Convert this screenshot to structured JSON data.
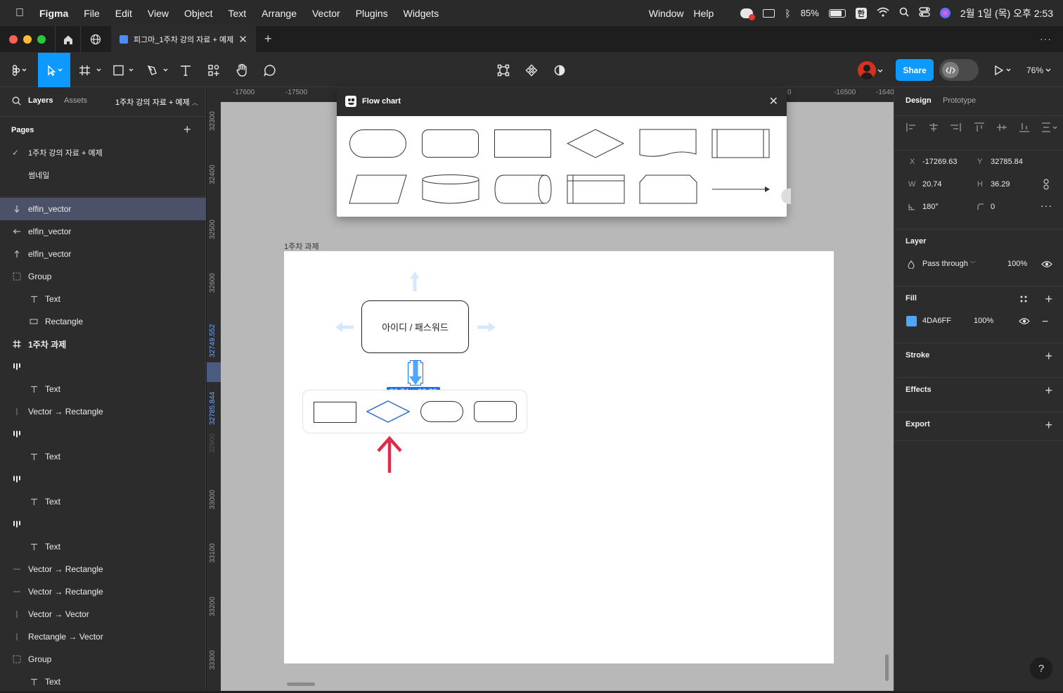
{
  "menubar": {
    "apple": "",
    "items": [
      "Figma",
      "File",
      "Edit",
      "View",
      "Object",
      "Text",
      "Arrange",
      "Vector",
      "Plugins",
      "Widgets"
    ],
    "right_items": [
      "Window",
      "Help"
    ],
    "battery": "85%",
    "ime": "한",
    "datetime": "2월 1일 (목) 오후 2:53"
  },
  "tabbar": {
    "tab_title": "피그마_1주차 강의 자료 + 예제",
    "add": "+",
    "more": "···"
  },
  "toolbar": {
    "share_label": "Share",
    "zoom": "76%"
  },
  "left_panel": {
    "tab_layers": "Layers",
    "tab_assets": "Assets",
    "file_name": "1주차 강의 자료 + 예제",
    "pages_title": "Pages",
    "pages": [
      {
        "label": "1주차 강의 자료 + 예제",
        "active": true
      },
      {
        "label": "썸네일",
        "active": false
      }
    ],
    "layers": [
      {
        "label": "elfin_vector",
        "icon": "vector-down-icon",
        "indent": 0,
        "selected": true
      },
      {
        "label": "elfin_vector",
        "icon": "vector-left-icon",
        "indent": 0
      },
      {
        "label": "elfin_vector",
        "icon": "vector-up-icon",
        "indent": 0
      },
      {
        "label": "Group",
        "icon": "group-icon",
        "indent": 0
      },
      {
        "label": "Text",
        "icon": "text-icon",
        "indent": 1
      },
      {
        "label": "Rectangle",
        "icon": "rectangle-icon",
        "indent": 1
      },
      {
        "label": "1주차 과제",
        "icon": "frame-icon",
        "indent": 0,
        "bold": true
      },
      {
        "label": "",
        "icon": "autolayout-icon",
        "indent": 0
      },
      {
        "label": "Text",
        "icon": "text-icon",
        "indent": 1
      },
      {
        "label": "Vector → Rectangle",
        "icon": "line-icon",
        "indent": 0
      },
      {
        "label": "",
        "icon": "autolayout-icon",
        "indent": 0
      },
      {
        "label": "Text",
        "icon": "text-icon",
        "indent": 1
      },
      {
        "label": "",
        "icon": "autolayout-icon",
        "indent": 0
      },
      {
        "label": "Text",
        "icon": "text-icon",
        "indent": 1
      },
      {
        "label": "",
        "icon": "autolayout-icon",
        "indent": 0
      },
      {
        "label": "Text",
        "icon": "text-icon",
        "indent": 1
      },
      {
        "label": "Vector → Rectangle",
        "icon": "hline-icon",
        "indent": 0
      },
      {
        "label": "Vector → Rectangle",
        "icon": "hline-icon",
        "indent": 0
      },
      {
        "label": "Vector → Vector",
        "icon": "line-icon",
        "indent": 0
      },
      {
        "label": "Rectangle → Vector",
        "icon": "line-icon",
        "indent": 0
      },
      {
        "label": "Group",
        "icon": "group-icon",
        "indent": 0
      },
      {
        "label": "Text",
        "icon": "text-icon",
        "indent": 1
      }
    ]
  },
  "rulers": {
    "h_ticks": [
      "-17600",
      "-17500",
      "-16500",
      "-1640"
    ],
    "h_partial": "0",
    "v_ticks": [
      "32300",
      "32400",
      "32500",
      "32600",
      "33000",
      "33100",
      "33200",
      "33300"
    ],
    "v_highlight_top": "32749.552",
    "v_highlight_bottom": "32785.844",
    "v_faded": "32900"
  },
  "flow_chart": {
    "title": "Flow chart"
  },
  "canvas": {
    "frame_label": "1주차 과제",
    "login_box_text": "아이디 / 패스워드",
    "size_badge": "20.74 × 36.29"
  },
  "right_panel": {
    "tab_design": "Design",
    "tab_prototype": "Prototype",
    "x_label": "X",
    "x_value": "-17269.63",
    "y_label": "Y",
    "y_value": "32785.84",
    "w_label": "W",
    "w_value": "20.74",
    "h_label": "H",
    "h_value": "36.29",
    "rotation": "180°",
    "radius": "0",
    "layer_title": "Layer",
    "blend_mode": "Pass through",
    "layer_opacity": "100%",
    "fill_title": "Fill",
    "fill_hex": "4DA6FF",
    "fill_color": "#4DA6FF",
    "fill_opacity": "100%",
    "stroke_title": "Stroke",
    "effects_title": "Effects",
    "export_title": "Export",
    "help": "?"
  }
}
